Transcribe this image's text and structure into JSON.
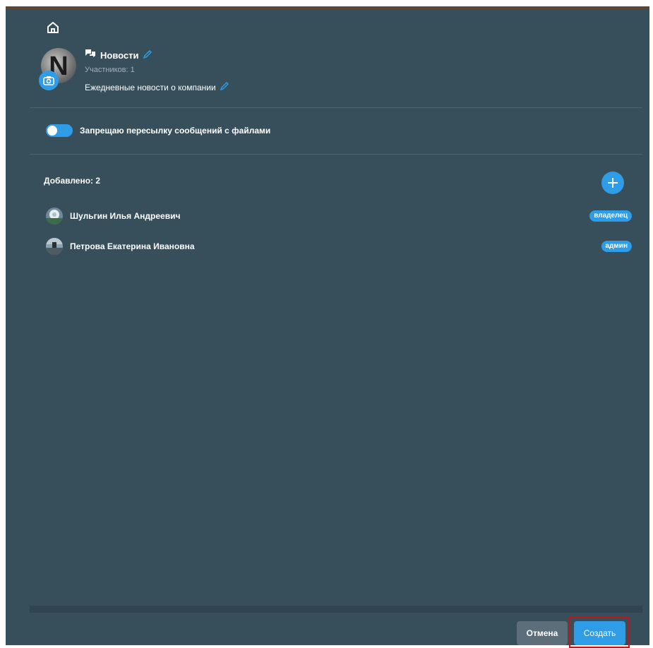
{
  "chat": {
    "title": "Новости",
    "members_text": "Участников: 1",
    "description": "Ежедневные новости о компании",
    "avatar_letter": "N"
  },
  "settings": {
    "forward_toggle_label": "Запрещаю пересылку сообщений с файлами",
    "forward_toggle_on": true
  },
  "members": {
    "added_label": "Добавлено: 2",
    "list": [
      {
        "name": "Шульгин Илья Андреевич",
        "role": "владелец"
      },
      {
        "name": "Петрова Екатерина Ивановна",
        "role": "админ"
      }
    ]
  },
  "footer": {
    "cancel_label": "Отмена",
    "create_label": "Создать"
  },
  "icons": {
    "home": "home-icon",
    "camera": "camera-icon",
    "chat": "chat-bubbles-icon",
    "edit": "pencil-icon",
    "add": "plus-icon"
  },
  "colors": {
    "panel_bg": "#374e5b",
    "accent": "#2e9ce6",
    "cancel_bg": "#5b6e79",
    "highlight": "#c0161c"
  }
}
